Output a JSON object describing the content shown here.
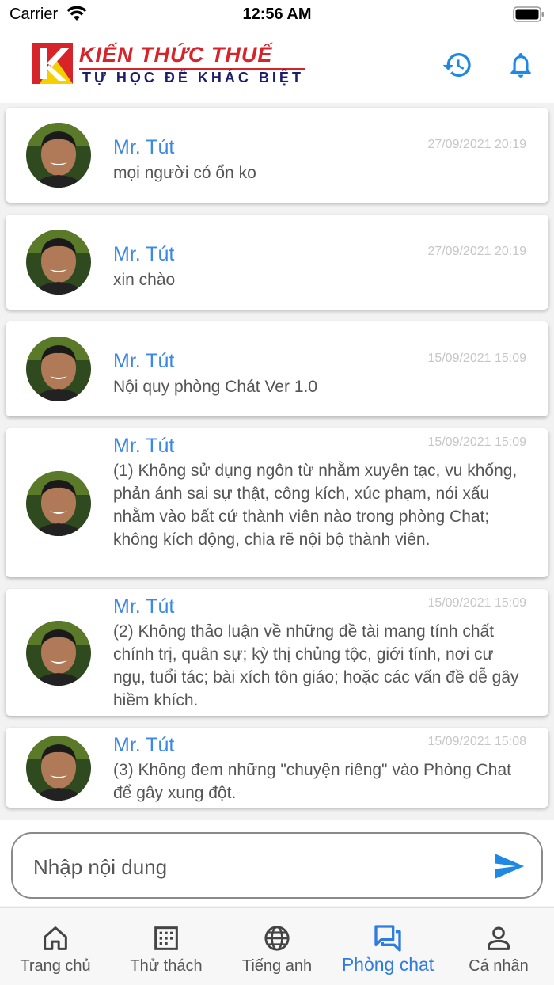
{
  "status_bar": {
    "carrier": "Carrier",
    "time": "12:56 AM"
  },
  "header": {
    "logo_title": "KIẾN THỨC THUẾ",
    "logo_subtitle": "TỰ HỌC ĐỂ KHÁC BIỆT",
    "history_icon": "history-icon",
    "bell_icon": "bell-icon",
    "accent_color": "#1e88e5"
  },
  "messages": [
    {
      "sender": "Mr. Tút",
      "time": "27/09/2021 20:19",
      "text": "mọi người có ổn ko"
    },
    {
      "sender": "Mr. Tút",
      "time": "27/09/2021 20:19",
      "text": "xin chào"
    },
    {
      "sender": "Mr. Tút",
      "time": "15/09/2021 15:09",
      "text": "Nội quy phòng Chát Ver 1.0"
    },
    {
      "sender": "Mr. Tút",
      "time": "15/09/2021 15:09",
      "text": "(1) Không sử dụng ngôn từ nhằm xuyên tạc, vu khống, phản ánh sai sự thật, công kích, xúc phạm, nói xấu nhằm vào bất cứ thành viên nào trong phòng Chat; không kích động, chia rẽ nội bộ thành viên."
    },
    {
      "sender": "Mr. Tút",
      "time": "15/09/2021 15:09",
      "text": "(2) Không thảo luận về những đề tài mang tính chất chính trị, quân sự; kỳ thị chủng tộc, giới tính, nơi cư ngụ, tuổi tác; bài xích tôn giáo; hoặc các vấn đề dễ gây hiềm khích."
    },
    {
      "sender": "Mr. Tút",
      "time": "15/09/2021 15:08",
      "text": "(3) Không đem những \"chuyện riêng\" vào Phòng Chat để gây xung đột."
    }
  ],
  "composer": {
    "placeholder": "Nhập nội dung",
    "send_icon": "send-icon"
  },
  "bottom_nav": {
    "active_color": "#2f7ce0",
    "items": [
      {
        "label": "Trang chủ",
        "icon": "home-icon"
      },
      {
        "label": "Thử thách",
        "icon": "grid-calendar-icon"
      },
      {
        "label": "Tiếng anh",
        "icon": "globe-icon"
      },
      {
        "label": "Phòng chat",
        "icon": "chat-icon",
        "active": true
      },
      {
        "label": "Cá nhân",
        "icon": "person-icon"
      }
    ]
  }
}
